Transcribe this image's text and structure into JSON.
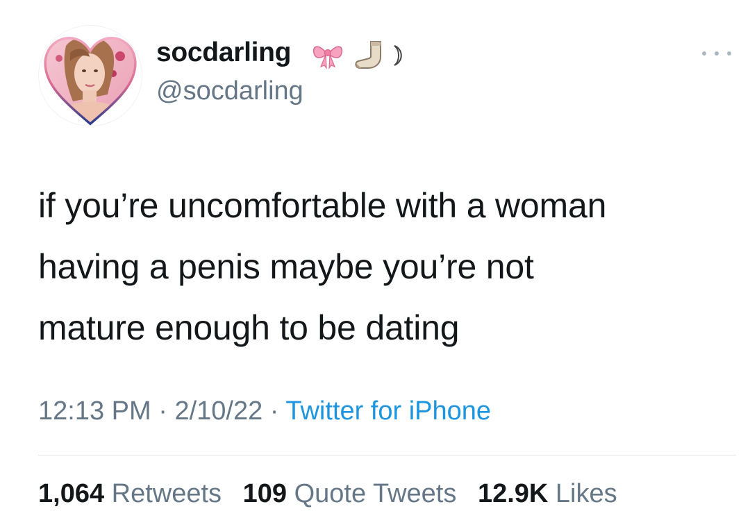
{
  "user": {
    "display_name": "socdarling",
    "handle": "@socdarling",
    "name_emojis": [
      "bow-icon",
      "sock-icon",
      "crescent-moon-icon"
    ],
    "avatar": "heart-framed-profile-photo"
  },
  "tweet": {
    "text_lines": [
      "if you’re uncomfortable with a woman",
      "having a penis maybe you’re not",
      "mature enough to be dating"
    ]
  },
  "meta": {
    "time": "12:13 PM",
    "separator": "·",
    "date": "2/10/22",
    "source": "Twitter for iPhone"
  },
  "stats": {
    "retweets_count": "1,064",
    "retweets_label": "Retweets",
    "quotes_count": "109",
    "quotes_label": "Quote Tweets",
    "likes_count": "12.9K",
    "likes_label": "Likes"
  },
  "colors": {
    "text_primary": "#14171a",
    "text_secondary": "#657786",
    "link": "#1b95e0",
    "divider": "#dfe3e6",
    "heart_frame_pink": "#e8a3b8",
    "heart_frame_blue": "#2f3f8f"
  }
}
